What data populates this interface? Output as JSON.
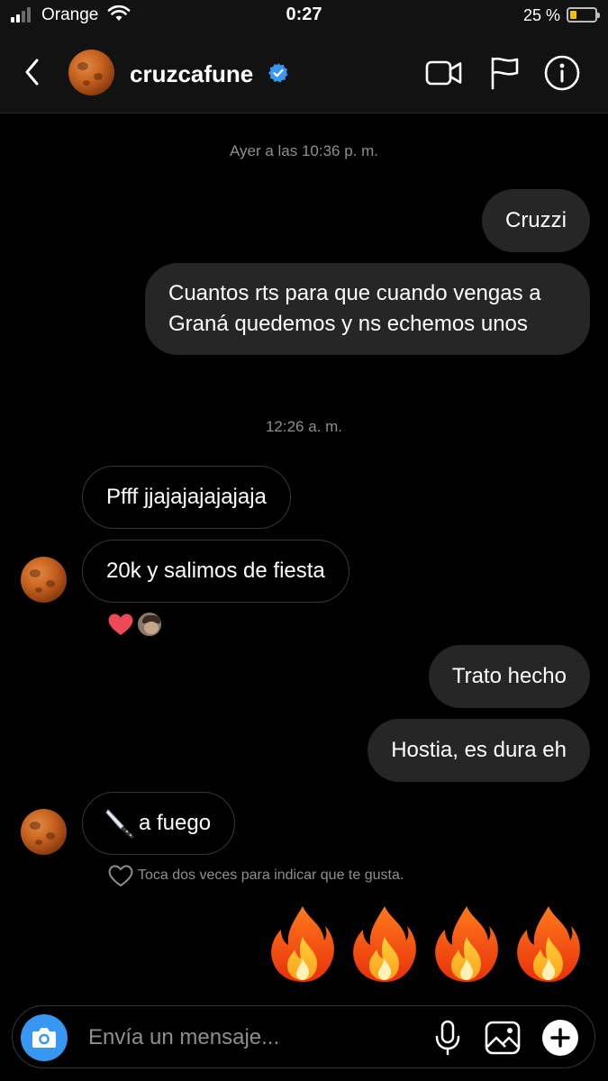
{
  "status_bar": {
    "carrier": "Orange",
    "time": "0:27",
    "battery_percent": "25 %",
    "battery_level": 0.25,
    "signal_bars": 2,
    "battery_color": "#f2c200"
  },
  "header": {
    "username": "cruzcafune",
    "verified": true,
    "icons": [
      "back-chevron-icon",
      "video-call-icon",
      "flag-icon",
      "info-icon"
    ]
  },
  "conversation": {
    "timestamp_1": "Ayer a las 10:36 p. m.",
    "timestamp_2": "12:26 a. m.",
    "messages": [
      {
        "direction": "out",
        "text": "Cruzzi"
      },
      {
        "direction": "out",
        "text": "Cuantos rts para que cuando vengas a Graná quedemos y ns echemos unos"
      },
      {
        "direction": "in",
        "text": "Pfff jjajajajajajaja"
      },
      {
        "direction": "in",
        "text": "20k y salimos de fiesta"
      },
      {
        "direction": "out",
        "text": "Trato hecho"
      },
      {
        "direction": "out",
        "text": "Hostia, es dura eh"
      },
      {
        "direction": "in",
        "text": "🔪a fuego",
        "emoji": "knife",
        "caption": "a fuego"
      },
      {
        "direction": "out",
        "text": "🔥🔥🔥🔥",
        "emoji": "fire",
        "count": 4
      }
    ],
    "reaction": "heart",
    "like_hint": "Toca dos veces para indicar que te gusta."
  },
  "composer": {
    "placeholder": "Envía un mensaje...",
    "icons": [
      "camera-icon",
      "microphone-icon",
      "gallery-icon",
      "plus-icon"
    ]
  },
  "colors": {
    "background": "#000000",
    "bar": "#121212",
    "outgoing_bubble": "#262626",
    "incoming_border": "#363636",
    "accent_blue": "#3897f0",
    "heart": "#ed4956",
    "muted_text": "#8e8e8e"
  }
}
